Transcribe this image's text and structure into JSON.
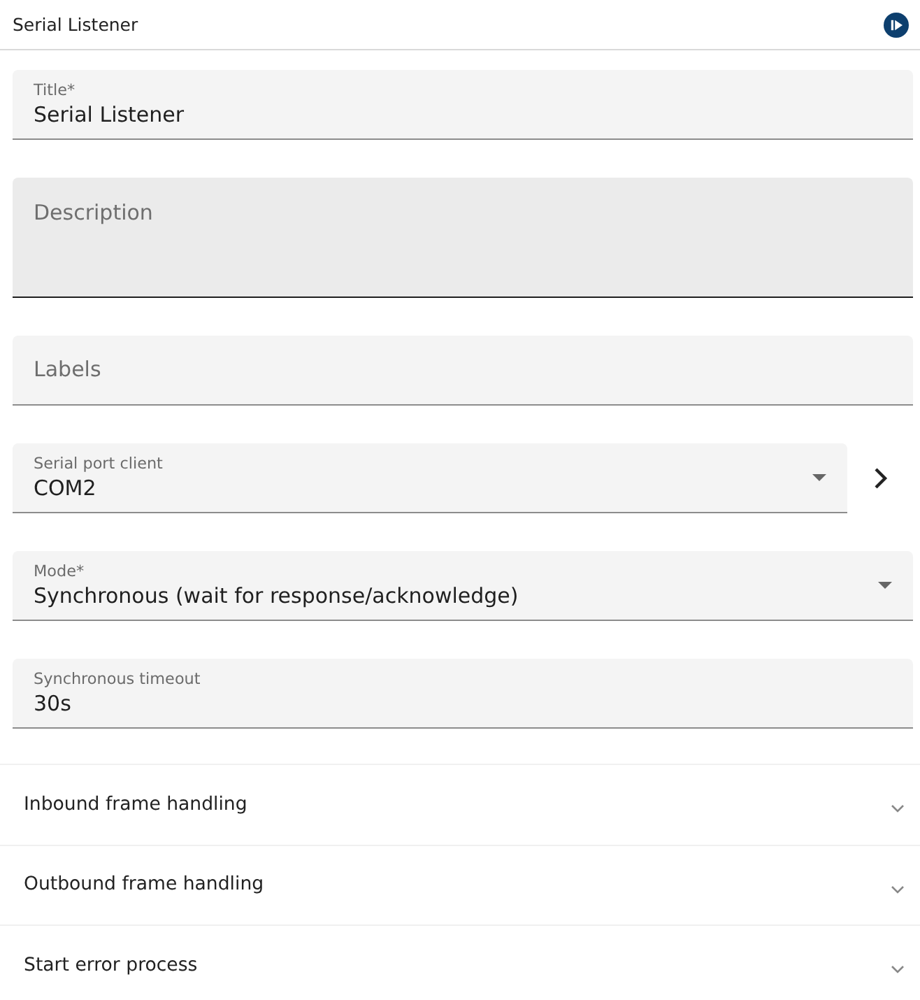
{
  "header": {
    "title": "Serial Listener"
  },
  "fields": [
    {
      "kind": "text",
      "label": "Title*",
      "value": "Serial Listener",
      "hovered": false,
      "open_button": false
    },
    {
      "kind": "textarea",
      "label": "Description",
      "hovered": true,
      "open_button": false
    },
    {
      "kind": "text",
      "label": "Labels",
      "hovered": false,
      "open_button": false
    },
    {
      "kind": "select",
      "label": "Serial port client",
      "value": "COM2",
      "hovered": false,
      "open_button": true
    },
    {
      "kind": "select",
      "label": "Mode*",
      "value": "Synchronous (wait for response/acknowledge)",
      "hovered": false,
      "open_button": false
    },
    {
      "kind": "text",
      "label": "Synchronous timeout",
      "value": "30s",
      "hovered": false,
      "open_button": false
    }
  ],
  "sections": [
    {
      "title": "Inbound frame handling",
      "expanded": false
    },
    {
      "title": "Outbound frame handling",
      "expanded": false
    },
    {
      "title": "Start error process",
      "expanded": false
    }
  ]
}
